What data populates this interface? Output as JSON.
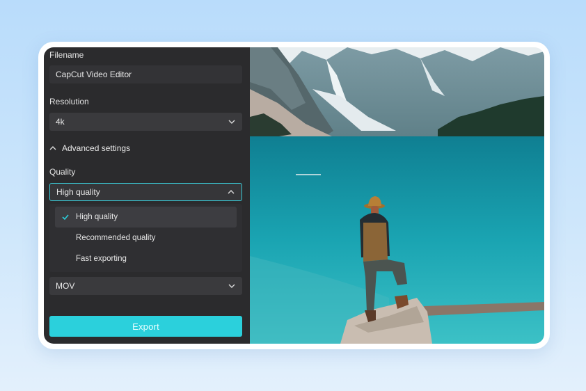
{
  "filename": {
    "label": "Filename",
    "value": "CapCut Video Editor"
  },
  "resolution": {
    "label": "Resolution",
    "value": "4k",
    "icon": "chevron-down-icon"
  },
  "advanced": {
    "label": "Advanced settings",
    "icon": "chevron-up-icon",
    "expanded": true
  },
  "quality": {
    "label": "Quality",
    "value": "High quality",
    "icon": "chevron-up-icon",
    "options": [
      "High quality",
      "Recommended quality",
      "Fast exporting"
    ],
    "selected_index": 0
  },
  "format": {
    "value": "MOV",
    "icon": "chevron-down-icon"
  },
  "export_button": {
    "label": "Export"
  },
  "colors": {
    "accent": "#2bd0dc",
    "panel": "#2b2b2d"
  }
}
